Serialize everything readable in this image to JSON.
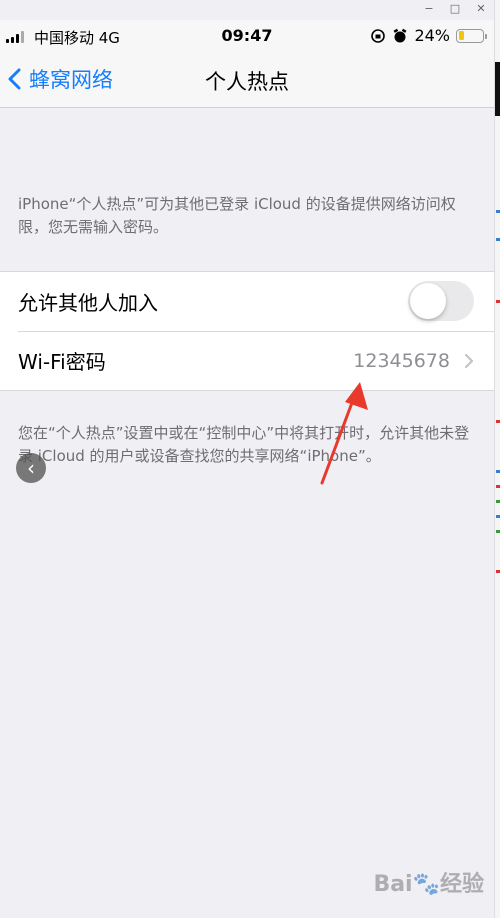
{
  "window": {
    "minimize": "−",
    "maximize": "□",
    "close": "✕"
  },
  "statusbar": {
    "carrier": "中国移动  4G",
    "time": "09:47",
    "battery_percent": "24%",
    "battery_level": 0.24,
    "icons": [
      "signal-icon",
      "rotation-lock-icon",
      "alarm-icon",
      "battery-icon"
    ]
  },
  "nav": {
    "back_label": "蜂窝网络",
    "title": "个人热点"
  },
  "intro": {
    "text": "iPhone“个人热点”可为其他已登录 iCloud 的设备提供网络访问权限，您无需输入密码。"
  },
  "settings": {
    "allow_others_label": "允许其他人加入",
    "allow_others_on": false,
    "wifi_password_label": "Wi-Fi密码",
    "wifi_password_value": "12345678"
  },
  "footer": {
    "text": "您在“个人热点”设置中或在“控制中心”中将其打开时，允许其他未登录 iCloud 的用户或设备查找您的共享网络“iPhone”。"
  },
  "overlay": {
    "left_arrow": "‹"
  },
  "watermark": {
    "text": "Bai🐾经验"
  },
  "colors": {
    "accent": "#157efb",
    "annotation_arrow": "#e8392c",
    "background": "#efeff4"
  }
}
